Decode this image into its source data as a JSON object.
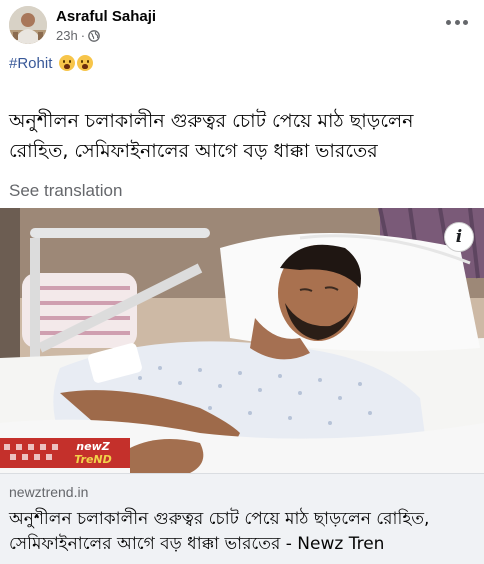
{
  "post": {
    "author": "Asraful Sahaji",
    "time": "23h",
    "separator": "·",
    "hashtag": "#Rohit",
    "emoji_icons": [
      "crying-face-icon",
      "crying-face-icon"
    ],
    "text_line1": "অনুশীলন চলাকালীন গুরুত্বর চোট পেয়ে মাঠ ছাড়লেন",
    "text_line2": "রোহিত, সেমিফাইনালের আগে বড় ধাক্কা ভারতের",
    "see_translation": "See translation",
    "info_label": "i"
  },
  "image": {
    "watermark_line1": "newZ",
    "watermark_line2": "TreND"
  },
  "link": {
    "domain": "newztrend.in",
    "title_line1": "অনুশীলন চলাকালীন গুরুত্বর চোট পেয়ে মাঠ ছাড়লেন রোহিত,",
    "title_line2": "সেমিফাইনালের আগে বড় ধাক্কা ভারতের - Newz Tren"
  },
  "colors": {
    "hashtag": "#385898",
    "secondary_text": "#65676b",
    "link_card_bg": "#f0f2f5"
  }
}
